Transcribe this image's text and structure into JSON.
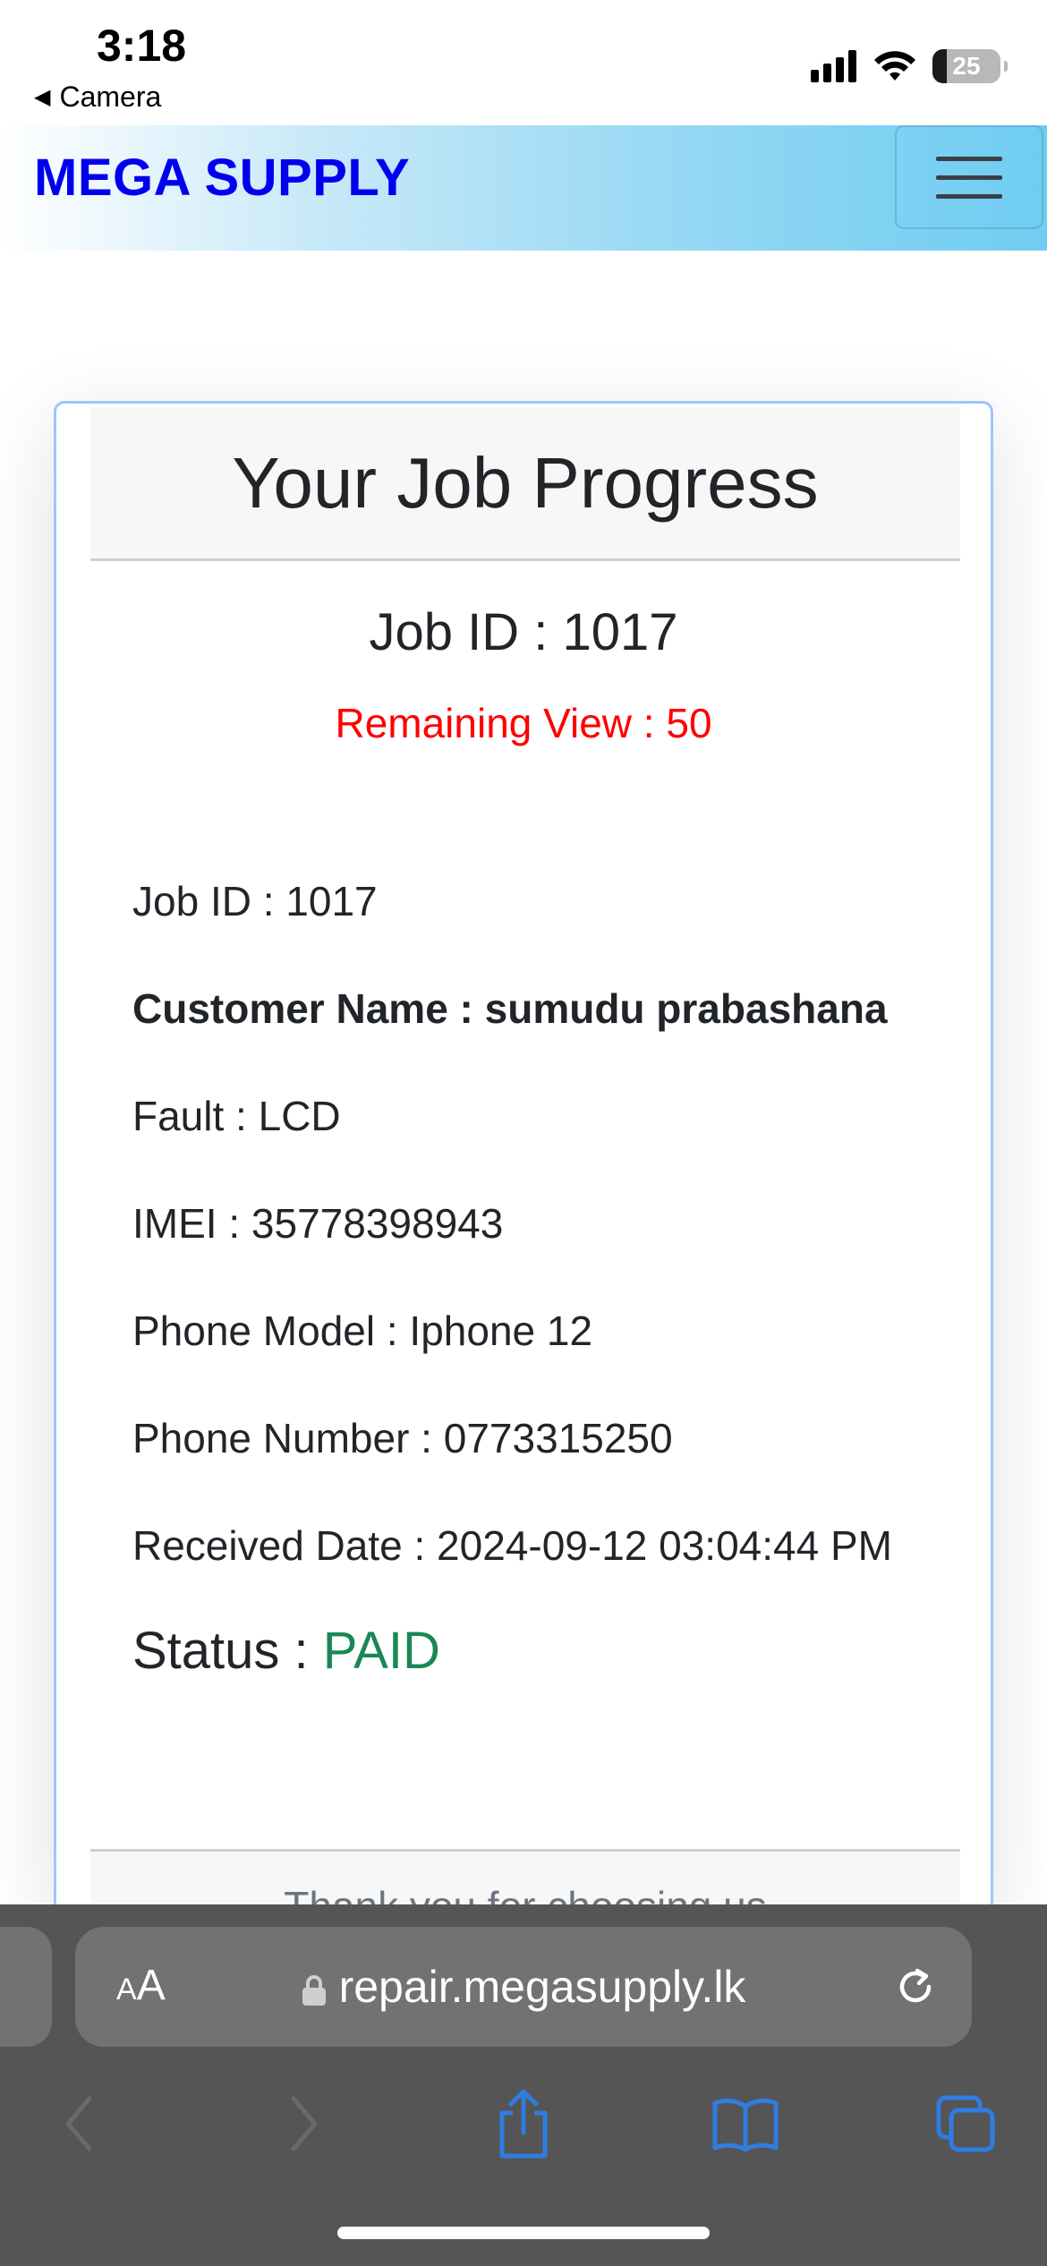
{
  "status_bar": {
    "time": "3:18",
    "back_app": "Camera",
    "battery_level": "25"
  },
  "header": {
    "brand": "MEGA SUPPLY"
  },
  "card": {
    "title": "Your Job Progress",
    "job_id_heading": "Job ID : 1017",
    "remaining_view": "Remaining View : 50",
    "details": {
      "job_id": "Job ID : 1017",
      "customer_name": "Customer Name : sumudu prabashana",
      "fault": "Fault : LCD",
      "imei": "IMEI : 35778398943",
      "phone_model": "Phone Model : Iphone 12",
      "phone_number": "Phone Number : 0773315250",
      "received_date": "Received Date : 2024-09-12 03:04:44 PM"
    },
    "status_label": "Status :",
    "status_value": "PAID",
    "footer": "Thank you for choosing us"
  },
  "browser": {
    "aa_small": "A",
    "aa_large": "A",
    "url": "repair.megasupply.lk"
  },
  "colors": {
    "brand": "#0000ee",
    "remaining": "#ff0000",
    "status_paid": "#198754",
    "toolbar_blue": "#2f7de1"
  }
}
